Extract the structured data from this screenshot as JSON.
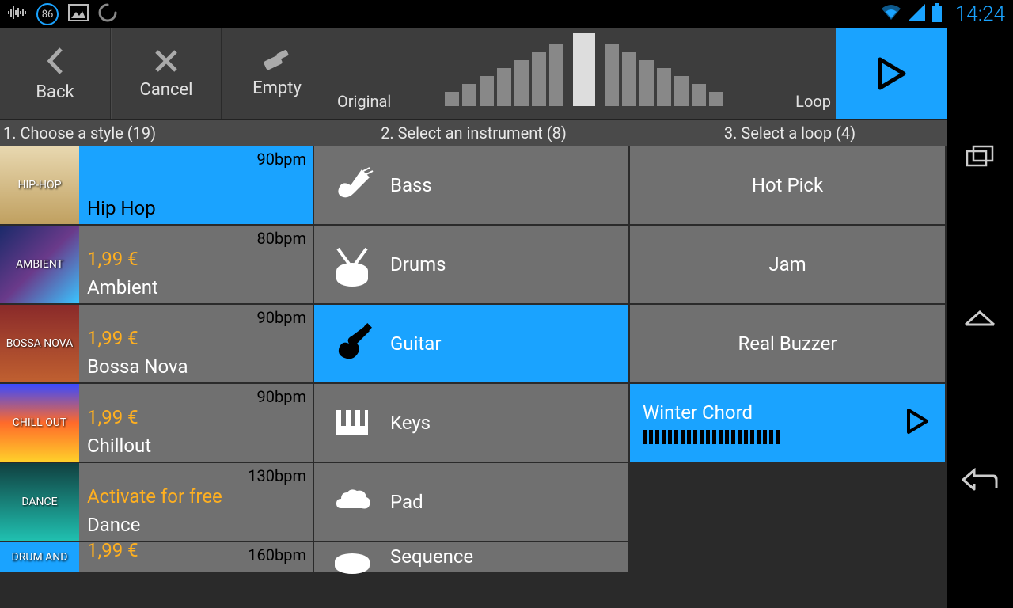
{
  "status": {
    "badge": "86",
    "time": "14:24"
  },
  "toolbar": {
    "back": "Back",
    "cancel": "Cancel",
    "empty": "Empty",
    "original": "Original",
    "loop": "Loop"
  },
  "tabs": {
    "style": "1. Choose a style (19)",
    "instrument": "2. Select an instrument (8)",
    "loop": "3. Select a loop (4)"
  },
  "styles": [
    {
      "name": "Hip Hop",
      "bpm": "90bpm",
      "price": "",
      "selected": true,
      "thumbClass": "thumb-hiphop",
      "thumbText": "Hip-Hop"
    },
    {
      "name": "Ambient",
      "bpm": "80bpm",
      "price": "1,99 €",
      "thumbClass": "thumb-ambient",
      "thumbText": "Ambient"
    },
    {
      "name": "Bossa Nova",
      "bpm": "90bpm",
      "price": "1,99 €",
      "thumbClass": "thumb-bossa",
      "thumbText": "Bossa Nova"
    },
    {
      "name": "Chillout",
      "bpm": "90bpm",
      "price": "1,99 €",
      "thumbClass": "thumb-chill",
      "thumbText": "Chill Out"
    },
    {
      "name": "Dance",
      "bpm": "130bpm",
      "price": "Activate for free",
      "thumbClass": "thumb-dance",
      "thumbText": "Dance"
    },
    {
      "name": "",
      "bpm": "160bpm",
      "price": "1,99 €",
      "thumbClass": "thumb-drum",
      "thumbText": "drum and",
      "partial": true
    }
  ],
  "instruments": [
    {
      "name": "Bass",
      "icon": "bass"
    },
    {
      "name": "Drums",
      "icon": "drums"
    },
    {
      "name": "Guitar",
      "icon": "guitar",
      "selected": true
    },
    {
      "name": "Keys",
      "icon": "keys"
    },
    {
      "name": "Pad",
      "icon": "pad"
    },
    {
      "name": "Sequence",
      "icon": "sequence",
      "partial": true
    }
  ],
  "loops": [
    {
      "name": "Hot Pick"
    },
    {
      "name": "Jam"
    },
    {
      "name": "Real Buzzer"
    },
    {
      "name": "Winter Chord",
      "selected": true,
      "playable": true
    }
  ]
}
